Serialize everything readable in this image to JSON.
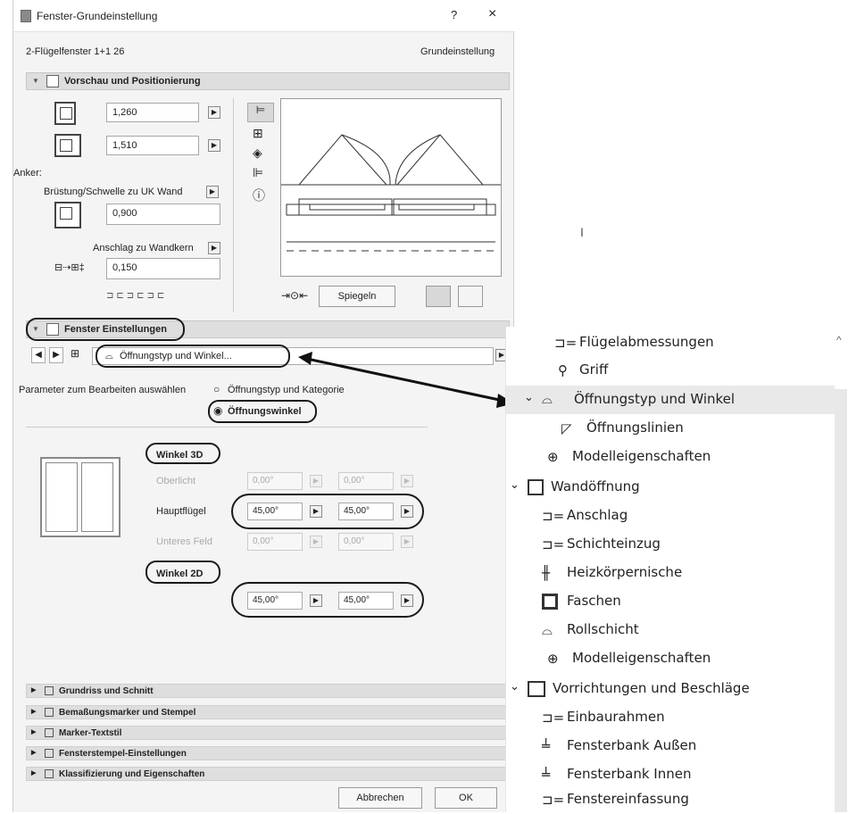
{
  "window": {
    "title": "Fenster-Grundeinstellung",
    "help": "?",
    "close": "×"
  },
  "header": {
    "left": "2-Flügelfenster 1+1 26",
    "right": "Grundeinstellung"
  },
  "preview": {
    "title": "Vorschau und Positionierung",
    "width": "1,260",
    "height": "1,510",
    "anker": "Anker:",
    "bruestung_label": "Brüstung/Schwelle zu UK Wand",
    "bruestung": "0,900",
    "anschlag_label": "Anschlag zu Wandkern",
    "anschlag": "0,150",
    "mirror_button": "Spiegeln"
  },
  "fenster": {
    "title": "Fenster Einstellungen",
    "subpage": "Öffnungstyp und Winkel...",
    "param_label": "Parameter zum Bearbeiten auswählen",
    "opt1": "Öffnungstyp und Kategorie",
    "opt2": "Öffnungswinkel",
    "winkel3d": "Winkel 3D",
    "oberlicht": "Oberlicht",
    "oberlicht_v1": "0,00°",
    "oberlicht_v2": "0,00°",
    "hauptfluegel": "Hauptflügel",
    "haupt_v1": "45,00°",
    "haupt_v2": "45,00°",
    "unteres": "Unteres Feld",
    "unteres_v1": "0,00°",
    "unteres_v2": "0,00°",
    "winkel2d": "Winkel 2D",
    "w2d_v1": "45,00°",
    "w2d_v2": "45,00°"
  },
  "bottom_sections": [
    "Grundriss und Schnitt",
    "Bemaßungsmarker und Stempel",
    "Marker-Textstil",
    "Fensterstempel-Einstellungen",
    "Klassifizierung und Eigenschaften"
  ],
  "buttons": {
    "cancel": "Abbrechen",
    "ok": "OK"
  },
  "tree": {
    "items": [
      "Flügelabmessungen",
      "Griff",
      "Öffnungstyp und Winkel",
      "Öffnungslinien",
      "Modelleigenschaften",
      "Wandöffnung",
      "Anschlag",
      "Schichteinzug",
      "Heizkörpernische",
      "Faschen",
      "Rollschicht",
      "Modelleigenschaften",
      "Vorrichtungen und Beschläge",
      "Einbaurahmen",
      "Fensterbank Außen",
      "Fensterbank Innen",
      "Fenstereinfassung"
    ]
  }
}
